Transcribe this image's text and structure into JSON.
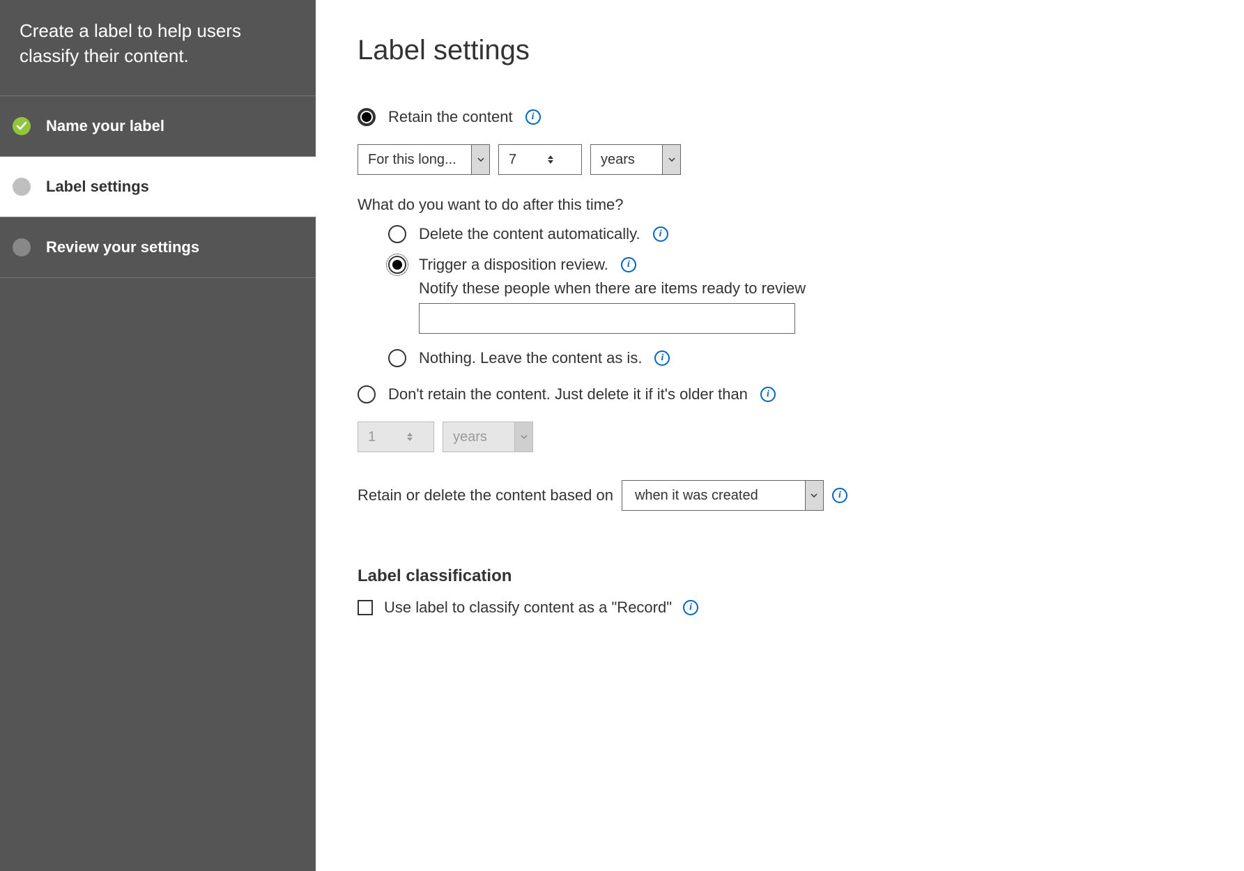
{
  "sidebar": {
    "header": "Create a label to help users classify their content.",
    "steps": [
      {
        "label": "Name your label",
        "state": "done"
      },
      {
        "label": "Label settings",
        "state": "current"
      },
      {
        "label": "Review your settings",
        "state": "pending"
      }
    ]
  },
  "main": {
    "title": "Label settings",
    "retain": {
      "label": "Retain the content",
      "selected": true,
      "duration_mode": "For this long...",
      "duration_value": "7",
      "duration_unit": "years",
      "after_question": "What do you want to do after this time?",
      "after_options": {
        "delete_auto": {
          "label": "Delete the content automatically.",
          "selected": false
        },
        "disposition": {
          "label": "Trigger a disposition review.",
          "selected": true,
          "notify_label": "Notify these people when there are items ready to review",
          "notify_value": ""
        },
        "nothing": {
          "label": "Nothing. Leave the content as is.",
          "selected": false
        }
      }
    },
    "dont_retain": {
      "label": "Don't retain the content. Just delete it if it's older than",
      "selected": false,
      "duration_value": "1",
      "duration_unit": "years"
    },
    "based_on": {
      "label": "Retain or delete the content based on",
      "value": "when it was created"
    },
    "classification": {
      "heading": "Label classification",
      "record_label": "Use label to classify content as a \"Record\"",
      "record_checked": false
    }
  }
}
